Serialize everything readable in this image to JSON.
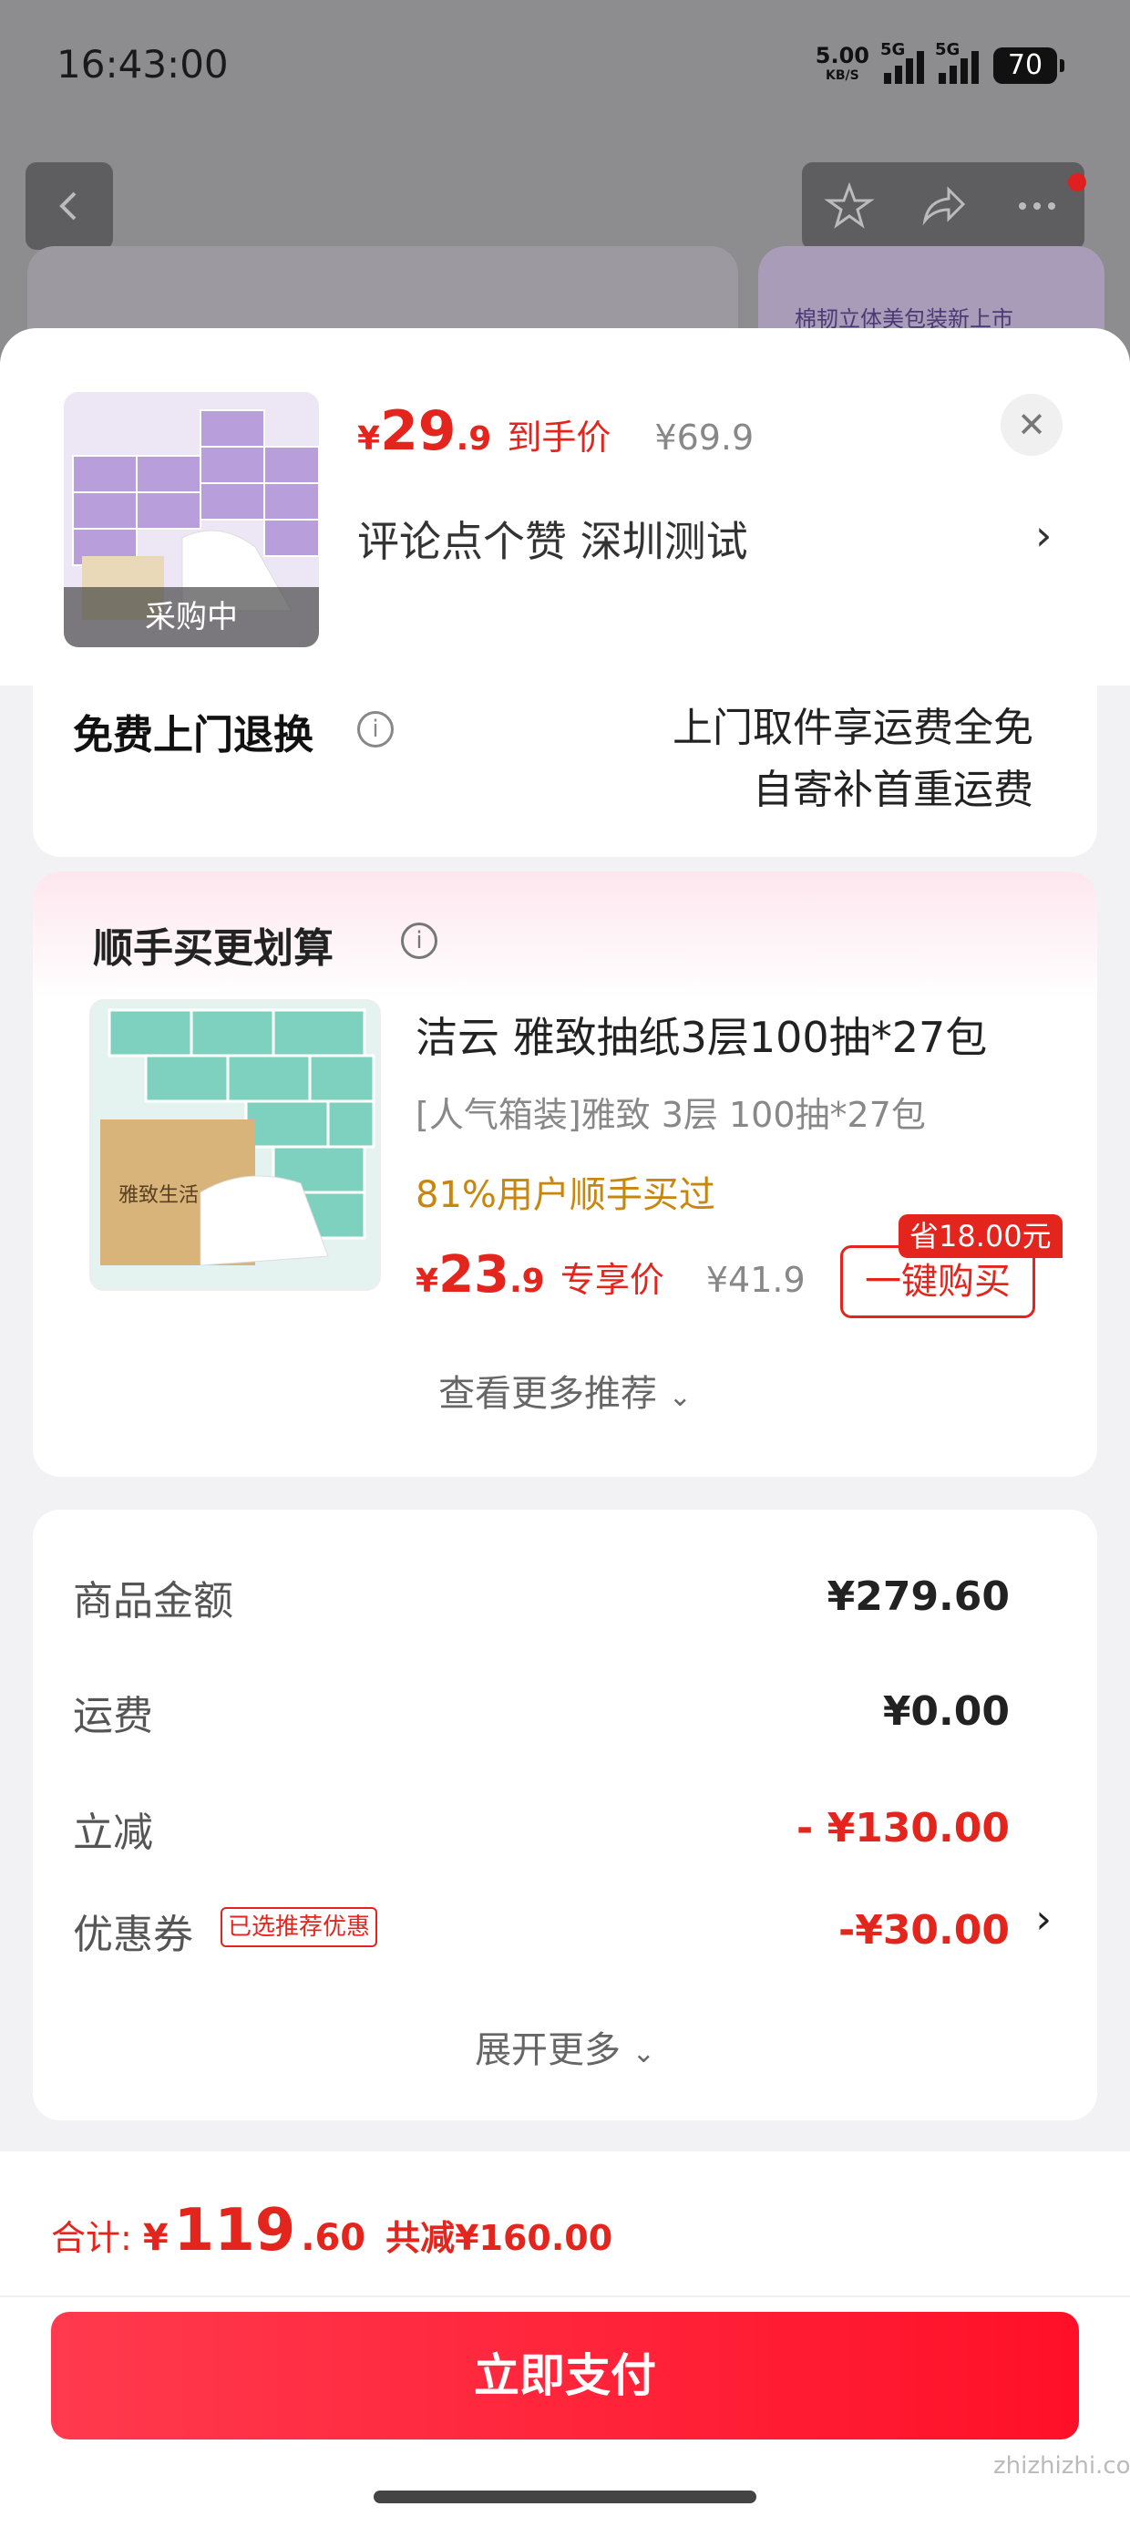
{
  "status_bar": {
    "time": "16:43:00",
    "net_speed_value": "5.00",
    "net_speed_unit": "KB/S",
    "signal1": "5G",
    "signal2": "5G",
    "battery": "70"
  },
  "background": {
    "banner_text": "棉韧立体美包装新上市"
  },
  "header": {
    "currency": "¥",
    "price_int": "29",
    "price_dec": ".9",
    "price_label": "到手价",
    "original_price": "¥69.9",
    "spec_text": "评论点个赞  深圳测试",
    "thumb_badge": "采购中"
  },
  "return_card": {
    "title": "免费上门退换",
    "line1": "上门取件享运费全免",
    "line2": "自寄补首重运费"
  },
  "bundle": {
    "title": "顺手买更划算",
    "product_name": "洁云 雅致抽纸3层100抽*27包",
    "product_desc": "[人气箱装]雅致 3层 100抽*27包",
    "percent_text": "81%用户顺手买过",
    "currency": "¥",
    "price_int": "23",
    "price_dec": ".9",
    "price_label": "专享价",
    "original_price": "¥41.9",
    "save_badge": "省18.00元",
    "buy_button": "一键购买",
    "more_label": "查看更多推荐",
    "box_text": "雅致生活"
  },
  "summary": {
    "rows": [
      {
        "label": "商品金额",
        "value": "¥279.60"
      },
      {
        "label": "运费",
        "value": "¥0.00"
      },
      {
        "label": "立减",
        "value": "- ¥130.00"
      },
      {
        "label": "优惠券",
        "value": "-¥30.00"
      }
    ],
    "coupon_tag": "已选推荐优惠",
    "expand_label": "展开更多"
  },
  "footer": {
    "total_label": "合计:",
    "currency": "¥",
    "total_int": "119",
    "total_dec": ".60",
    "total_saved": "共减¥160.00",
    "pay_button": "立即支付",
    "watermark": "zhizhizhi.com"
  },
  "colors": {
    "accent_red": "#e3251d",
    "recommend_orange": "#c8860c",
    "pay_gradient_start": "#ff3a4e",
    "pay_gradient_end": "#ff1028"
  },
  "icons": [
    "back-icon",
    "star-icon",
    "share-icon",
    "more-icon",
    "close-icon",
    "chevron-right-icon",
    "info-icon",
    "chevron-down-icon"
  ]
}
